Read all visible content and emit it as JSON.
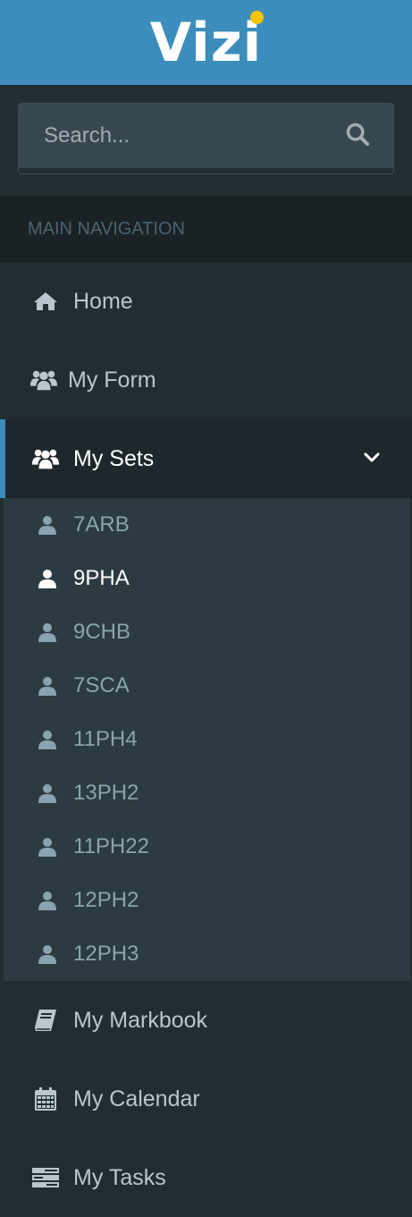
{
  "app": {
    "logo_text": "Vizi"
  },
  "search": {
    "placeholder": "Search..."
  },
  "nav": {
    "header": "MAIN NAVIGATION",
    "items": [
      {
        "label": "Home",
        "icon": "home-icon"
      },
      {
        "label": "My Form",
        "icon": "users-icon"
      },
      {
        "label": "My Sets",
        "icon": "users-icon",
        "expanded": true
      },
      {
        "label": "My Markbook",
        "icon": "book-icon"
      },
      {
        "label": "My Calendar",
        "icon": "calendar-icon"
      },
      {
        "label": "My Tasks",
        "icon": "tasks-icon"
      }
    ],
    "sets": [
      {
        "label": "7ARB"
      },
      {
        "label": "9PHA",
        "active": true
      },
      {
        "label": "9CHB"
      },
      {
        "label": "7SCA"
      },
      {
        "label": "11PH4"
      },
      {
        "label": "13PH2"
      },
      {
        "label": "11PH22"
      },
      {
        "label": "12PH2"
      },
      {
        "label": "12PH3"
      }
    ]
  },
  "colors": {
    "header_bg": "#3c8dbc",
    "sidebar_bg": "#222d32",
    "submenu_bg": "#2c3b41",
    "accent": "#3c8dbc",
    "logo_dot": "#f6c400"
  }
}
